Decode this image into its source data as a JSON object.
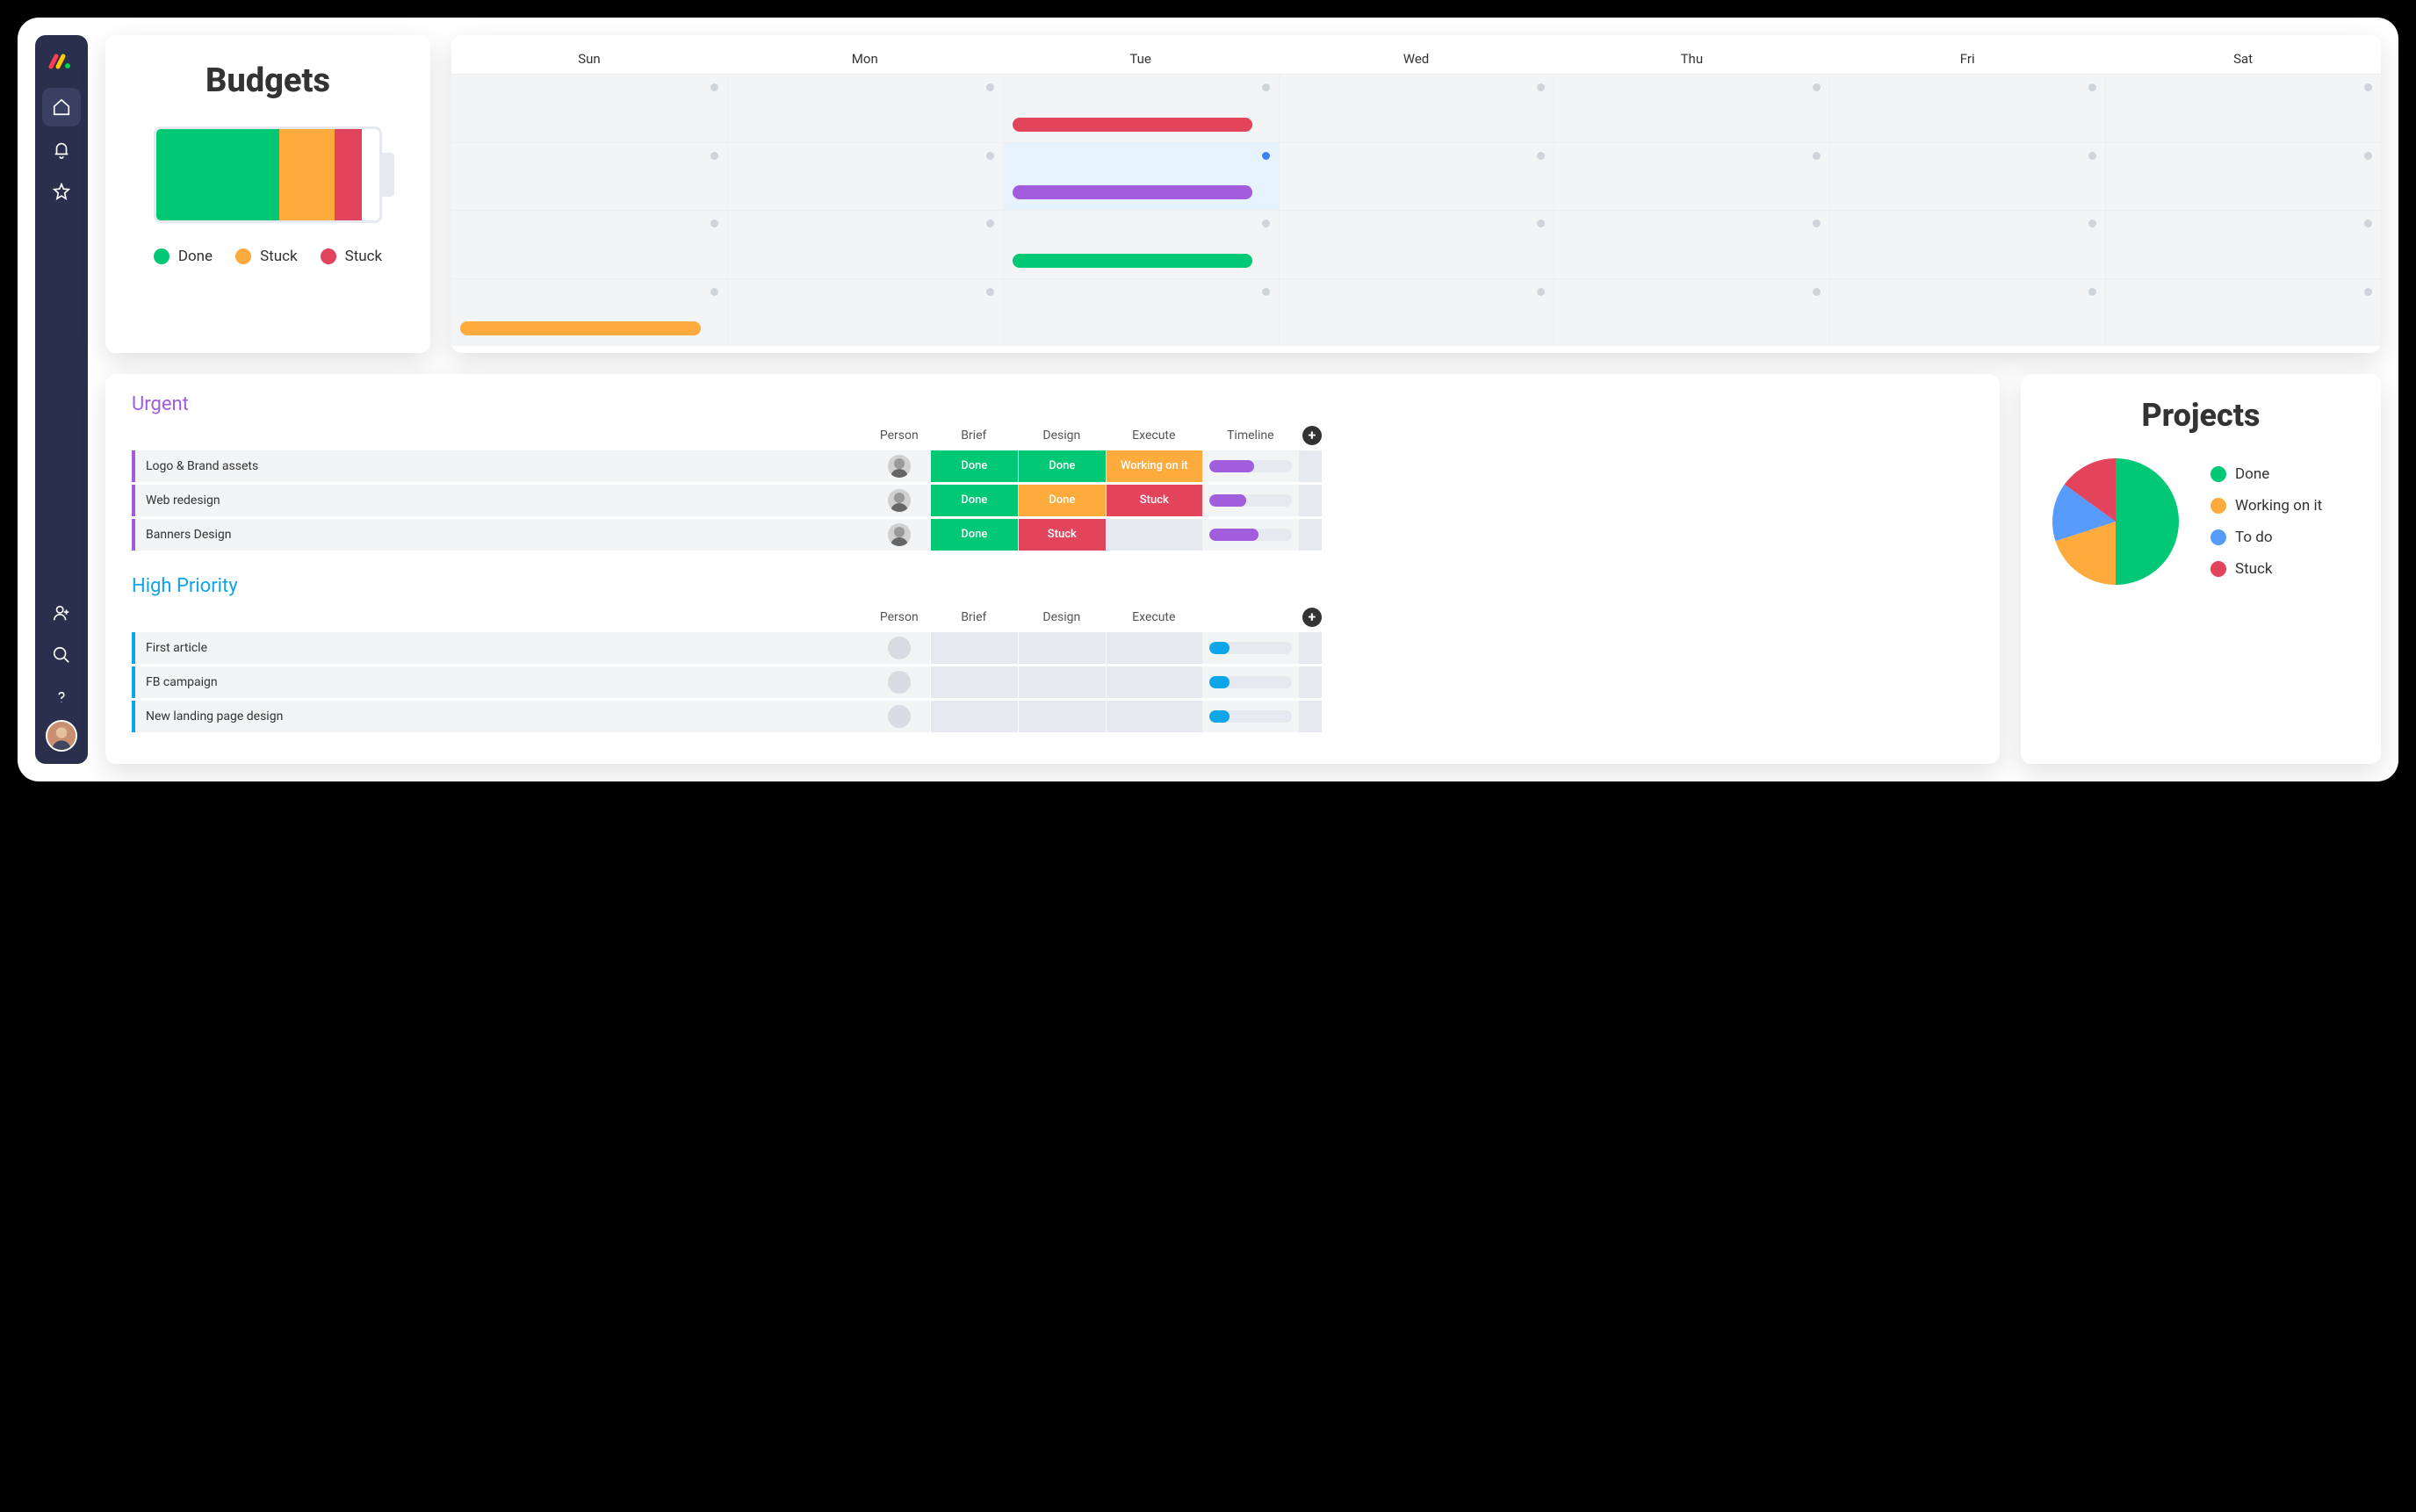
{
  "sidebar": {
    "items": [
      "home",
      "notifications",
      "favorites",
      "invite",
      "search",
      "help"
    ]
  },
  "budgets": {
    "title": "Budgets",
    "legend": [
      {
        "label": "Done",
        "color": "#00c875"
      },
      {
        "label": "Stuck",
        "color": "#fdab3d"
      },
      {
        "label": "Stuck",
        "color": "#e2445c"
      }
    ],
    "segments": [
      {
        "color": "#00c875",
        "pct": 55
      },
      {
        "color": "#fdab3d",
        "pct": 25
      },
      {
        "color": "#e2445c",
        "pct": 12
      }
    ]
  },
  "calendar": {
    "days": [
      "Sun",
      "Mon",
      "Tue",
      "Wed",
      "Thu",
      "Fri",
      "Sat"
    ],
    "events": [
      {
        "row": 0,
        "col": 2,
        "color": "#e2445c"
      },
      {
        "row": 1,
        "col": 2,
        "color": "#a25ddc",
        "dot": "blue",
        "hl": true
      },
      {
        "row": 2,
        "col": 2,
        "color": "#00c875"
      },
      {
        "row": 3,
        "col": 0,
        "color": "#fdab3d"
      }
    ]
  },
  "tasks": {
    "groups": [
      {
        "id": "urgent",
        "title": "Urgent",
        "columns": [
          "Person",
          "Brief",
          "Design",
          "Execute",
          "Timeline"
        ],
        "rows": [
          {
            "name": "Logo & Brand assets",
            "person": "m1",
            "cells": [
              {
                "label": "Done",
                "color": "#00c875"
              },
              {
                "label": "Done",
                "color": "#00c875"
              },
              {
                "label": "Working on it",
                "color": "#fdab3d"
              }
            ],
            "timeline": {
              "color": "#a25ddc",
              "pct": 55
            }
          },
          {
            "name": "Web redesign",
            "person": "f1",
            "cells": [
              {
                "label": "Done",
                "color": "#00c875"
              },
              {
                "label": "Done",
                "color": "#fdab3d"
              },
              {
                "label": "Stuck",
                "color": "#e2445c"
              }
            ],
            "timeline": {
              "color": "#a25ddc",
              "pct": 45
            }
          },
          {
            "name": "Banners Design",
            "person": "m2",
            "cells": [
              {
                "label": "Done",
                "color": "#00c875"
              },
              {
                "label": "Stuck",
                "color": "#e2445c"
              },
              {
                "label": "",
                "color": ""
              }
            ],
            "timeline": {
              "color": "#a25ddc",
              "pct": 60
            }
          }
        ]
      },
      {
        "id": "high",
        "title": "High Priority",
        "columns": [
          "Person",
          "Brief",
          "Design",
          "Execute"
        ],
        "rows": [
          {
            "name": "First article",
            "person": "",
            "cells": [
              {
                "label": "",
                "color": ""
              },
              {
                "label": "",
                "color": ""
              },
              {
                "label": "",
                "color": ""
              }
            ],
            "timeline": {
              "color": "#0ea5e9",
              "pct": 25
            }
          },
          {
            "name": "FB campaign",
            "person": "",
            "cells": [
              {
                "label": "",
                "color": ""
              },
              {
                "label": "",
                "color": ""
              },
              {
                "label": "",
                "color": ""
              }
            ],
            "timeline": {
              "color": "#0ea5e9",
              "pct": 25
            }
          },
          {
            "name": "New landing page design",
            "person": "",
            "cells": [
              {
                "label": "",
                "color": ""
              },
              {
                "label": "",
                "color": ""
              },
              {
                "label": "",
                "color": ""
              }
            ],
            "timeline": {
              "color": "#0ea5e9",
              "pct": 25
            }
          }
        ]
      }
    ]
  },
  "projects": {
    "title": "Projects",
    "legend": [
      {
        "label": "Done",
        "color": "#00c875"
      },
      {
        "label": "Working on it",
        "color": "#fdab3d"
      },
      {
        "label": "To do",
        "color": "#579bfc"
      },
      {
        "label": "Stuck",
        "color": "#e2445c"
      }
    ]
  },
  "chart_data": [
    {
      "type": "bar",
      "title": "Budgets",
      "categories": [
        "Done",
        "Stuck",
        "Stuck"
      ],
      "values": [
        55,
        25,
        12
      ],
      "ylim": [
        0,
        100
      ]
    },
    {
      "type": "pie",
      "title": "Projects",
      "series": [
        {
          "name": "Done",
          "value": 50,
          "color": "#00c875"
        },
        {
          "name": "Working on it",
          "value": 20,
          "color": "#fdab3d"
        },
        {
          "name": "To do",
          "value": 15,
          "color": "#579bfc"
        },
        {
          "name": "Stuck",
          "value": 15,
          "color": "#e2445c"
        }
      ]
    }
  ]
}
